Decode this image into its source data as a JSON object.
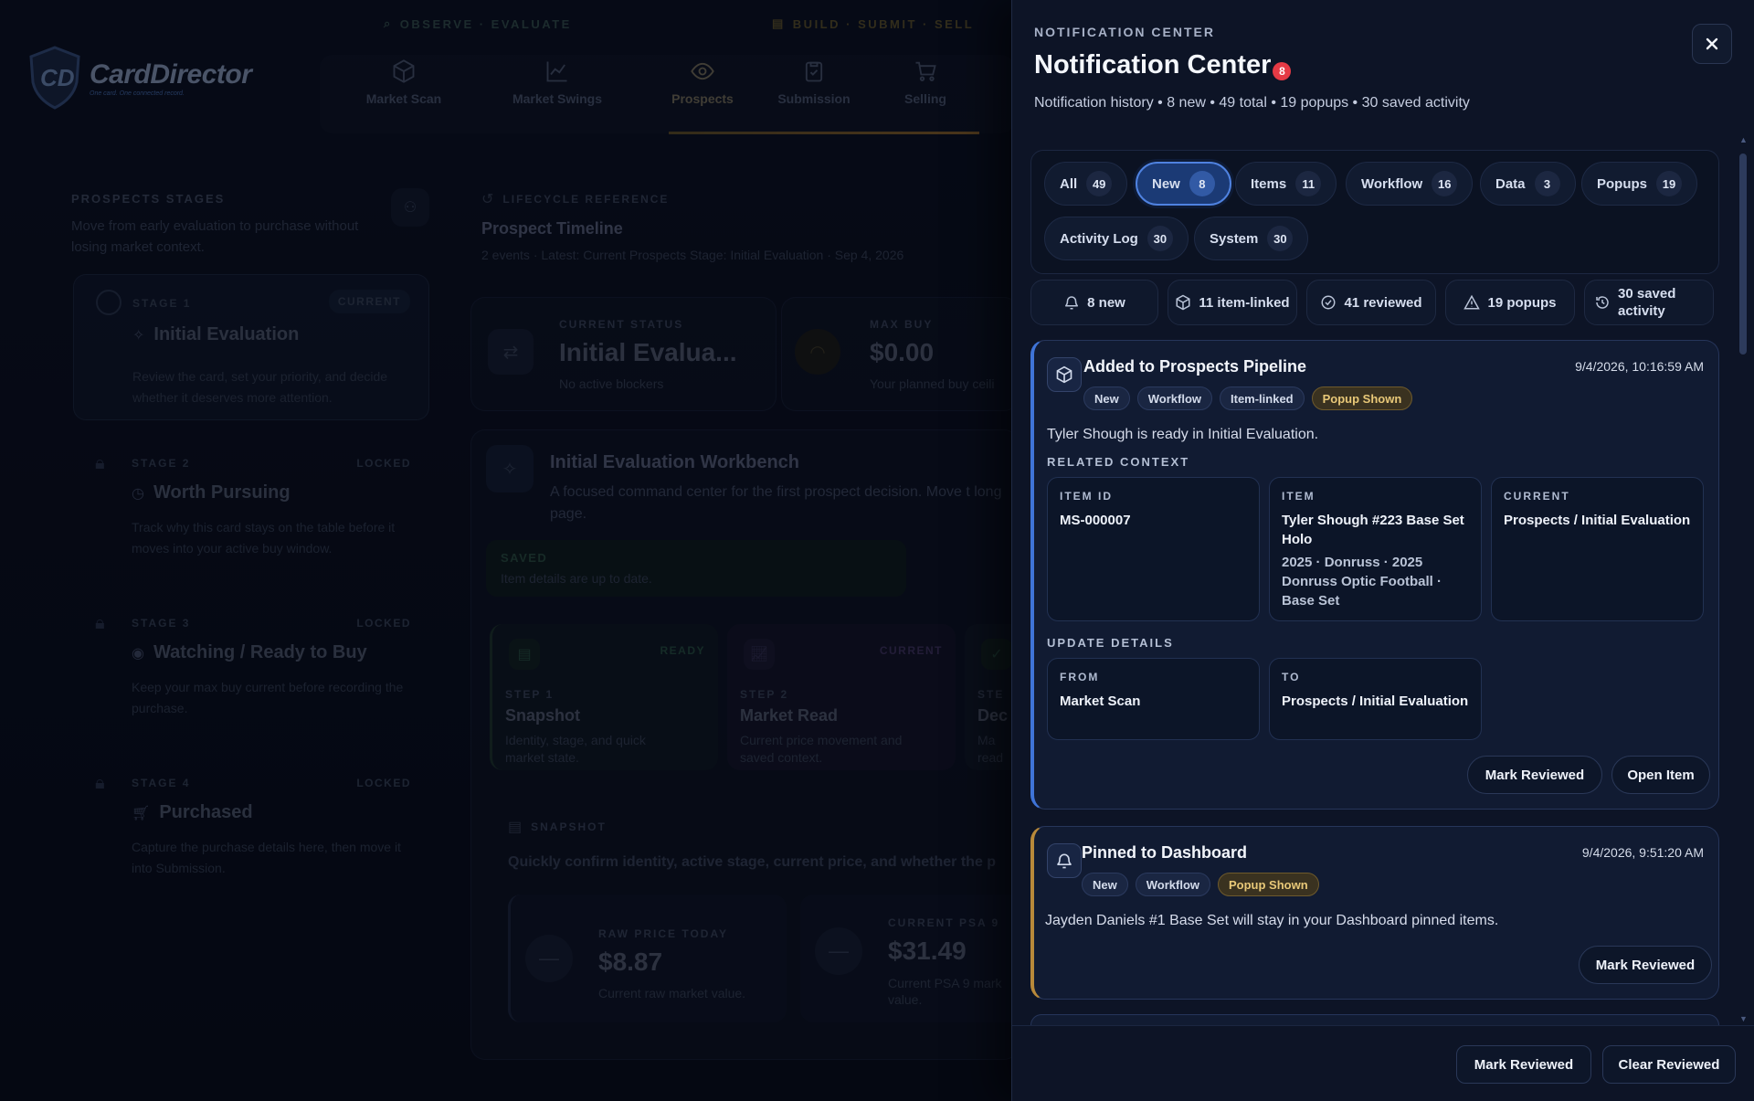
{
  "app": {
    "logo_text": "CardDirector",
    "logo_tagline": "One card. One connected record.",
    "nav_groups": [
      "OBSERVE · EVALUATE",
      "BUILD · SUBMIT · SELL"
    ],
    "nav_items": [
      {
        "label": "Market Scan",
        "icon": "cube-icon"
      },
      {
        "label": "Market Swings",
        "icon": "chart-line-icon"
      },
      {
        "label": "Prospects",
        "icon": "eye-icon",
        "active": true
      },
      {
        "label": "Submission",
        "icon": "clipboard-icon"
      },
      {
        "label": "Selling",
        "icon": "cart-icon"
      }
    ],
    "sidebar": {
      "heading": "PROSPECTS STAGES",
      "subtitle": "Move from early evaluation to purchase without losing market context.",
      "stages": [
        {
          "kicker": "STAGE 1",
          "badge": "CURRENT",
          "title": "Initial Evaluation",
          "desc": "Review the card, set your priority, and decide whether it deserves more attention."
        },
        {
          "kicker": "STAGE 2",
          "badge": "LOCKED",
          "title": "Worth Pursuing",
          "desc": "Track why this card stays on the table before it moves into your active buy window."
        },
        {
          "kicker": "STAGE 3",
          "badge": "LOCKED",
          "title": "Watching / Ready to Buy",
          "desc": "Keep your max buy current before recording the purchase."
        },
        {
          "kicker": "STAGE 4",
          "badge": "LOCKED",
          "title": "Purchased",
          "desc": "Capture the purchase details here, then move it into Submission."
        }
      ]
    },
    "main": {
      "lifecycle_kicker": "LIFECYCLE REFERENCE",
      "timeline_title": "Prospect Timeline",
      "timeline_sub": "2 events · Latest: Current Prospects Stage: Initial Evaluation · Sep 4, 2026",
      "status_kicker": "CURRENT STATUS",
      "status_value": "Initial Evalua...",
      "status_note": "No active blockers",
      "maxbuy_kicker": "MAX BUY",
      "maxbuy_value": "$0.00",
      "maxbuy_note": "Your planned buy ceili",
      "workbench_title": "Initial Evaluation Workbench",
      "workbench_desc": "A focused command center for the first prospect decision. Move t long page.",
      "saved_label": "SAVED",
      "saved_note": "Item details are up to date.",
      "steps": [
        {
          "kicker": "STEP 1",
          "badge": "READY",
          "title": "Snapshot",
          "desc": "Identity, stage, and quick market state."
        },
        {
          "kicker": "STEP 2",
          "badge": "CURRENT",
          "title": "Market Read",
          "desc": "Current price movement and saved context."
        },
        {
          "kicker": "STE",
          "badge": "",
          "title": "Dec",
          "desc": "Ma read"
        }
      ],
      "snapshot_kicker": "SNAPSHOT",
      "snapshot_desc": "Quickly confirm identity, active stage, current price, and whether the p",
      "raw_kicker": "RAW PRICE TODAY",
      "raw_value": "$8.87",
      "raw_note": "Current raw market value.",
      "psa_kicker": "CURRENT PSA 9",
      "psa_value": "$31.49",
      "psa_note": "Current PSA 9 mark value."
    }
  },
  "notification_center": {
    "kicker": "NOTIFICATION CENTER",
    "title": "Notification Center",
    "badge": "8",
    "summary": "Notification history • 8 new • 49 total • 19 popups • 30 saved activity",
    "filters": [
      {
        "label": "All",
        "count": "49"
      },
      {
        "label": "New",
        "count": "8",
        "active": true
      },
      {
        "label": "Items",
        "count": "11"
      },
      {
        "label": "Workflow",
        "count": "16"
      },
      {
        "label": "Data",
        "count": "3"
      },
      {
        "label": "Popups",
        "count": "19"
      },
      {
        "label": "Activity Log",
        "count": "30"
      },
      {
        "label": "System",
        "count": "30"
      }
    ],
    "stats": [
      {
        "label": "8 new",
        "icon": "bell-icon"
      },
      {
        "label": "11 item-linked",
        "icon": "cube-icon"
      },
      {
        "label": "41 reviewed",
        "icon": "check-circle-icon"
      },
      {
        "label": "19 popups",
        "icon": "warning-icon"
      },
      {
        "label": "30 saved activity",
        "icon": "history-icon"
      }
    ],
    "notifications": [
      {
        "title": "Added to Prospects Pipeline",
        "time": "9/4/2026, 10:16:59 AM",
        "tags": [
          "New",
          "Workflow",
          "Item-linked",
          "Popup Shown"
        ],
        "body": "Tyler Shough is ready in Initial Evaluation.",
        "related_heading": "RELATED CONTEXT",
        "item_id_label": "ITEM ID",
        "item_id": "MS-000007",
        "item_label": "ITEM",
        "item_name": "Tyler Shough #223 Base Set Holo",
        "item_detail": "2025 · Donruss · 2025 Donruss Optic Football · Base Set",
        "current_label": "CURRENT",
        "current_value": "Prospects / Initial Evaluation",
        "update_heading": "UPDATE DETAILS",
        "from_label": "FROM",
        "from_value": "Market Scan",
        "to_label": "TO",
        "to_value": "Prospects / Initial Evaluation",
        "mark_reviewed": "Mark Reviewed",
        "open_item": "Open Item"
      },
      {
        "title": "Pinned to Dashboard",
        "time": "9/4/2026, 9:51:20 AM",
        "tags": [
          "New",
          "Workflow",
          "Popup Shown"
        ],
        "body": "Jayden Daniels #1 Base Set will stay in your Dashboard pinned items.",
        "mark_reviewed": "Mark Reviewed"
      }
    ],
    "footer": {
      "mark_reviewed": "Mark Reviewed",
      "clear_reviewed": "Clear Reviewed"
    },
    "colors": {
      "accent": "#3f74d8",
      "badge": "#e53a45",
      "gold": "#e8c878",
      "panel": "#0d1426"
    }
  }
}
